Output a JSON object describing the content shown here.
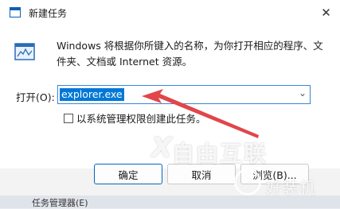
{
  "window": {
    "title": "新建任务",
    "close_glyph": "✕"
  },
  "description": "Windows 将根据你所键入的名称，为你打开相应的程序、文件夹、文档或 Internet 资源。",
  "open_field": {
    "label": "打开(O):",
    "value": "explorer.exe",
    "dropdown_glyph": "⌄"
  },
  "admin_checkbox": {
    "label": "以系统管理权限创建此任务。",
    "checked": false
  },
  "buttons": {
    "ok": "确定",
    "cancel": "取消",
    "browse": "浏览(B)..."
  },
  "watermarks": {
    "logo_text": "自由互联",
    "logo_mark": "X",
    "site_text": "好装机"
  },
  "taskbar": {
    "item_label": "任务管理器(E)"
  },
  "colors": {
    "accent": "#0078d7",
    "arrow": "#e0464a",
    "dialog_bg": "#f3f3f3",
    "content_bg": "#ffffff"
  },
  "icons": [
    "app-window-icon",
    "run-program-icon",
    "close-icon",
    "chevron-down-icon",
    "annotation-arrow-icon"
  ]
}
